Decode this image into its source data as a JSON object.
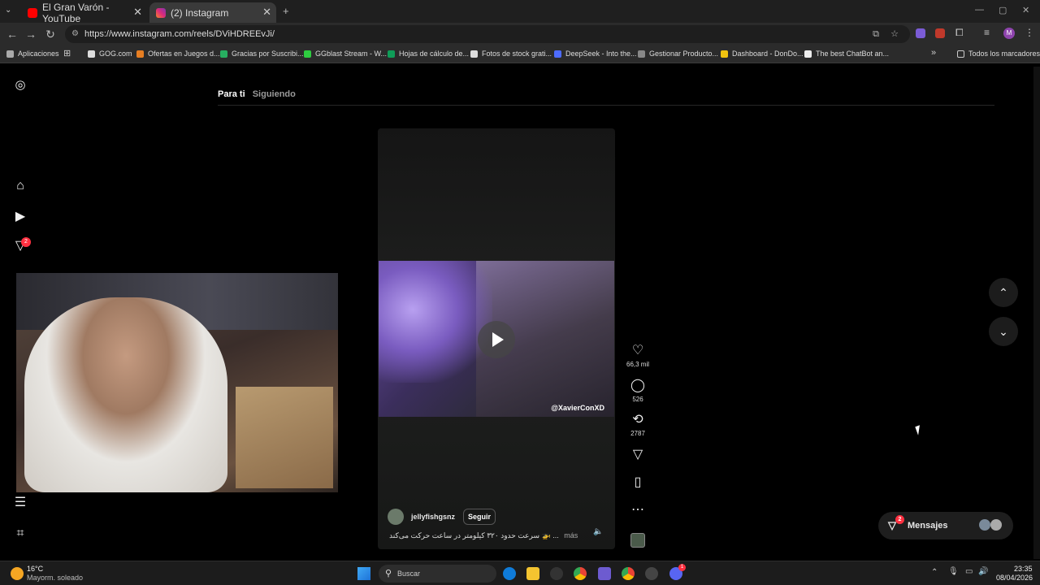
{
  "tabs": [
    {
      "title": "El Gran Varón - YouTube",
      "active": false
    },
    {
      "title": "(2) Instagram",
      "active": true
    }
  ],
  "address": {
    "url": "https://www.instagram.com/reels/DViHDREEvJi/"
  },
  "bookmarks": [
    "Aplicaciones",
    "GOG.com",
    "Ofertas en Juegos d...",
    "Gracias por Suscribi...",
    "GGblast Stream - W...",
    "Hojas de cálculo de...",
    "Fotos de stock grati...",
    "DeepSeek - Into the...",
    "Gestionar Producto...",
    "Dashboard - DonDo...",
    "The best ChatBot an..."
  ],
  "bookmarks_right": "Todos los marcadores",
  "instagram": {
    "notification_badge": "2",
    "feed_tabs": {
      "for_you": "Para ti",
      "following": "Siguiendo"
    },
    "reel": {
      "watermark": "@XavierConXD",
      "username": "jellyfishgsnz",
      "follow_label": "Seguir",
      "caption": "سرعت حدود ۳۲۰ کیلومتر در ساعت حرکت می‌کند 🚁 ...",
      "more_label": "más"
    },
    "actions": {
      "likes": "66,3 mil",
      "comments": "526",
      "reposts": "2787"
    },
    "messages": {
      "label": "Mensajes",
      "badge": "2"
    },
    "colors": {
      "accent_badge": "#ff3040"
    }
  },
  "taskbar": {
    "weather_temp": "16°C",
    "weather_desc": "Mayorm. soleado",
    "search_placeholder": "Buscar",
    "time": "23:35",
    "date": "08/04/2026",
    "discord_badge": "1"
  }
}
